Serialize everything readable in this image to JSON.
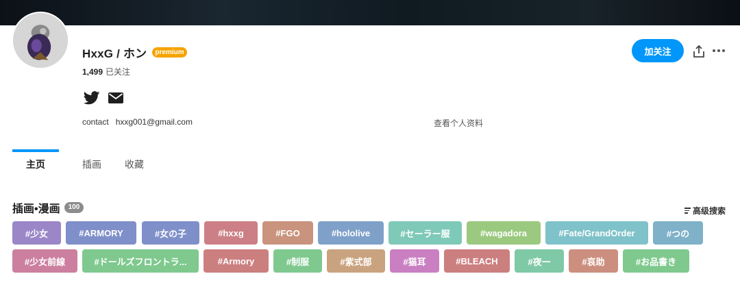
{
  "profile": {
    "name": "HxxG / ホン",
    "badge": "premium",
    "following_count": "1,499",
    "following_label": "已关注",
    "contact_label": "contact",
    "contact_email": "hxxg001@gmail.com",
    "view_profile": "查看个人资料",
    "follow_button": "加关注"
  },
  "tabs": [
    {
      "label": "主页"
    },
    {
      "label": "插画"
    },
    {
      "label": "收藏"
    }
  ],
  "section": {
    "title": "插画•漫画",
    "count": "100",
    "advanced_search": "高级搜索"
  },
  "tags": [
    {
      "label": "#少女",
      "color": "#9b86c8"
    },
    {
      "label": "#ARMORY",
      "color": "#7f8fc9"
    },
    {
      "label": "#女の子",
      "color": "#7f8fc9"
    },
    {
      "label": "#hxxg",
      "color": "#cc7f86"
    },
    {
      "label": "#FGO",
      "color": "#c9937d"
    },
    {
      "label": "#hololive",
      "color": "#7fa1c9"
    },
    {
      "label": "#セーラー服",
      "color": "#7fc9b8"
    },
    {
      "label": "#wagadora",
      "color": "#9bc97f"
    },
    {
      "label": "#Fate/GrandOrder",
      "color": "#7fc2c9"
    },
    {
      "label": "#つの",
      "color": "#7fb1c9"
    },
    {
      "label": "#少女前線",
      "color": "#cc7f9f"
    },
    {
      "label": "#ドールズフロントラ...",
      "color": "#7fc98f"
    },
    {
      "label": "#Armory",
      "color": "#cc7f7f"
    },
    {
      "label": "#制服",
      "color": "#7fc98f"
    },
    {
      "label": "#紫式部",
      "color": "#c9a37f"
    },
    {
      "label": "#猫耳",
      "color": "#c97fc2"
    },
    {
      "label": "#BLEACH",
      "color": "#cc7f7f"
    },
    {
      "label": "#夜一",
      "color": "#7fc9a6"
    },
    {
      "label": "#哀助",
      "color": "#cc8f7f"
    },
    {
      "label": "#お品書き",
      "color": "#7fc98f"
    }
  ],
  "icons": {
    "twitter": "twitter-icon",
    "mail": "mail-icon",
    "share": "share-icon",
    "more": "more-icon"
  }
}
